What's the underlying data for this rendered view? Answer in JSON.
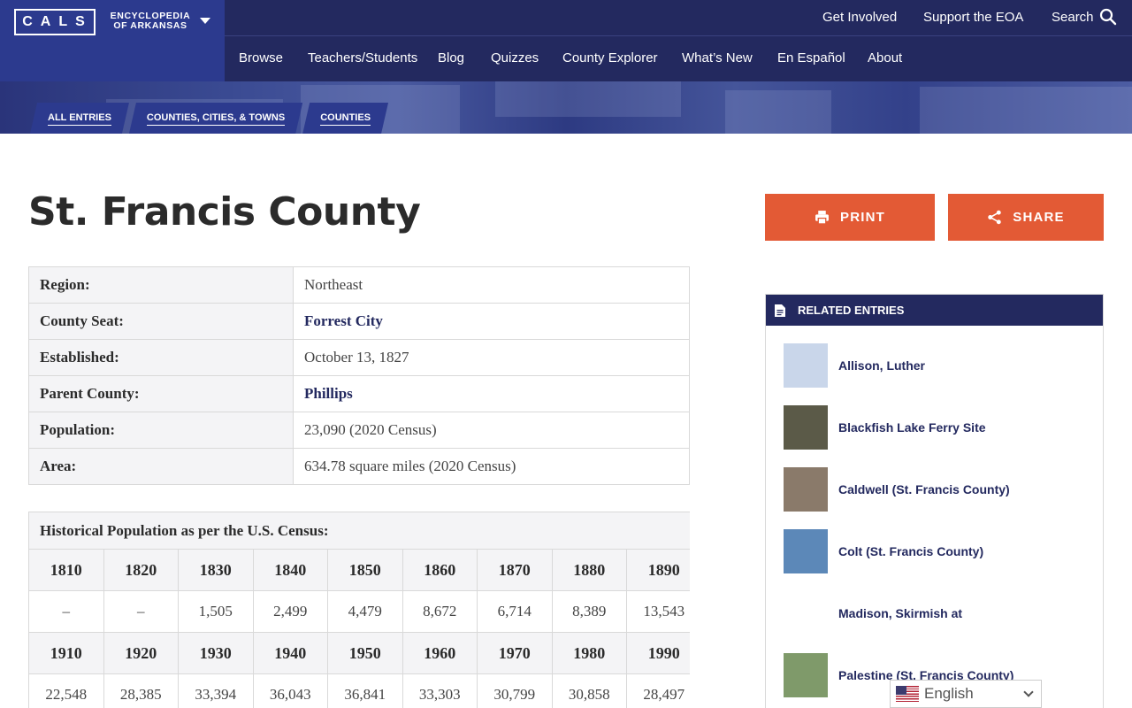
{
  "logo": {
    "cals": "CALS",
    "line1": "ENCYCLOPEDIA",
    "line2": "OF ARKANSAS"
  },
  "topbar": {
    "get_involved": "Get Involved",
    "support": "Support the EOA",
    "search": "Search"
  },
  "nav": [
    "Browse",
    "Teachers/Students",
    "Blog",
    "Quizzes",
    "County Explorer",
    "What’s New",
    "En Español",
    "About"
  ],
  "breadcrumbs": [
    "ALL ENTRIES",
    "COUNTIES, CITIES, & TOWNS",
    "COUNTIES"
  ],
  "page": {
    "title": "St. Francis County"
  },
  "info": [
    {
      "label": "Region:",
      "value": "Northeast",
      "link": false
    },
    {
      "label": "County Seat:",
      "value": "Forrest City",
      "link": true
    },
    {
      "label": "Established:",
      "value": "October 13, 1827",
      "link": false
    },
    {
      "label": "Parent County:",
      "value": "Phillips",
      "link": true
    },
    {
      "label": "Population:",
      "value": "23,090 (2020 Census)",
      "link": false
    },
    {
      "label": "Area:",
      "value": "634.78 square miles (2020 Census)",
      "link": false
    }
  ],
  "population": {
    "caption": "Historical Population as per the U.S. Census:",
    "rows": [
      {
        "years": [
          "1810",
          "1820",
          "1830",
          "1840",
          "1850",
          "1860",
          "1870",
          "1880",
          "1890"
        ],
        "values": [
          "–",
          "–",
          "1,505",
          "2,499",
          "4,479",
          "8,672",
          "6,714",
          "8,389",
          "13,543"
        ]
      },
      {
        "years": [
          "1910",
          "1920",
          "1930",
          "1940",
          "1950",
          "1960",
          "1970",
          "1980",
          "1990"
        ],
        "values": [
          "22,548",
          "28,385",
          "33,394",
          "36,043",
          "36,841",
          "33,303",
          "30,799",
          "30,858",
          "28,497"
        ]
      }
    ]
  },
  "actions": {
    "print": "PRINT",
    "share": "SHARE"
  },
  "related": {
    "heading": "RELATED ENTRIES",
    "items": [
      {
        "name": "Allison, Luther",
        "thumb": "#c9d6ea"
      },
      {
        "name": "Blackfish Lake Ferry Site",
        "thumb": "#5b5a48"
      },
      {
        "name": "Caldwell (St. Francis County)",
        "thumb": "#8a7a6a"
      },
      {
        "name": "Colt (St. Francis County)",
        "thumb": "#5c88b8"
      },
      {
        "name": "Madison, Skirmish at",
        "thumb": "#ffffff"
      },
      {
        "name": "Palestine (St. Francis County)",
        "thumb": "#7f9a6a"
      }
    ]
  },
  "translate": {
    "language": "English"
  },
  "colors": {
    "navy": "#23295f",
    "logo_blue": "#2c3a8e",
    "accent": "#e35a35"
  }
}
